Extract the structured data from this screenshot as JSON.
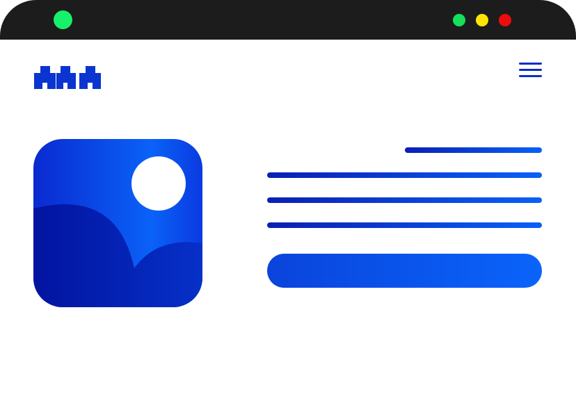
{
  "window": {
    "app_dot_color": "#16f06a",
    "controls": [
      {
        "name": "maximize",
        "color": "#16e05a"
      },
      {
        "name": "minimize",
        "color": "#ffe600"
      },
      {
        "name": "close",
        "color": "#ee0c0c"
      }
    ]
  },
  "header": {
    "logo_icon": "twin-block-logo-icon",
    "menu_icon": "hamburger-menu-icon"
  },
  "hero": {
    "image_icon": "image-placeholder-icon",
    "text_lines": 4,
    "cta_label": ""
  },
  "colors": {
    "titlebar": "#1c1c1c",
    "brand_dark": "#0a1fb4",
    "brand_light": "#0a60f8",
    "image_hill": "#0424b0",
    "sun": "#ffffff"
  }
}
